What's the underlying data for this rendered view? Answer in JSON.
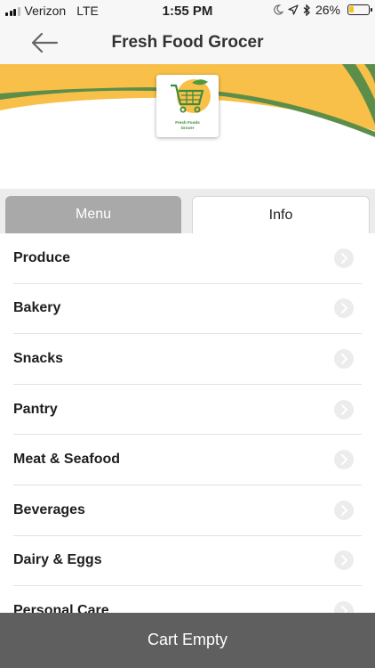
{
  "status_bar": {
    "carrier": "Verizon",
    "network": "LTE",
    "time": "1:55 PM",
    "battery_percent": "26%",
    "battery_level": 0.26,
    "icons": [
      "moon-icon",
      "location-arrow-icon",
      "bluetooth-icon"
    ]
  },
  "nav": {
    "title": "Fresh Food Grocer",
    "back_icon": "back-arrow-icon"
  },
  "banner": {
    "logo_line1": "Fresh Foods",
    "logo_line2": "Grocer",
    "colors": {
      "yellow": "#f8c048",
      "green": "#5c8e4a"
    }
  },
  "tabs": [
    {
      "label": "Menu",
      "active": true
    },
    {
      "label": "Info",
      "active": false
    }
  ],
  "categories": [
    {
      "label": "Produce"
    },
    {
      "label": "Bakery"
    },
    {
      "label": "Snacks"
    },
    {
      "label": "Pantry"
    },
    {
      "label": "Meat & Seafood"
    },
    {
      "label": "Beverages"
    },
    {
      "label": "Dairy & Eggs"
    },
    {
      "label": "Personal Care"
    }
  ],
  "cart": {
    "label": "Cart Empty"
  }
}
